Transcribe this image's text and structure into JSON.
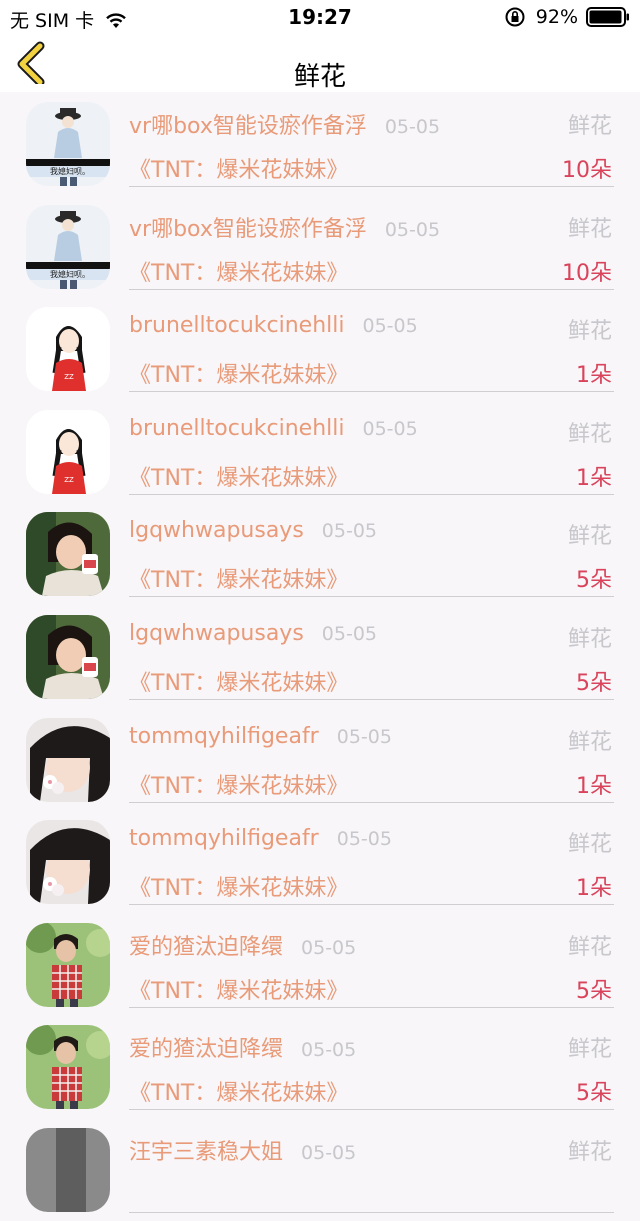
{
  "status_bar": {
    "carrier": "无 SIM 卡",
    "time": "19:27",
    "battery": "92%"
  },
  "nav": {
    "title": "鲜花",
    "back_icon": "chevron-left-icon"
  },
  "colors": {
    "accent": "#e99a78",
    "count": "#d9435b",
    "muted": "#c7c7cc"
  },
  "records": [
    {
      "avatar": "girl-hat-caption-avatar",
      "name": "vr哪box智能设瘀作备浮",
      "date": "05-05",
      "type": "鲜花",
      "work": "《TNT：爆米花妹妹》",
      "count": "10朵"
    },
    {
      "avatar": "girl-hat-caption-avatar",
      "name": "vr哪box智能设瘀作备浮",
      "date": "05-05",
      "type": "鲜花",
      "work": "《TNT：爆米花妹妹》",
      "count": "10朵"
    },
    {
      "avatar": "braids-girl-avatar",
      "name": "brunelltocukcinehlli",
      "date": "05-05",
      "type": "鲜花",
      "work": "《TNT：爆米花妹妹》",
      "count": "1朵"
    },
    {
      "avatar": "braids-girl-avatar",
      "name": "brunelltocukcinehlli",
      "date": "05-05",
      "type": "鲜花",
      "work": "《TNT：爆米花妹妹》",
      "count": "1朵"
    },
    {
      "avatar": "child-photo-avatar",
      "name": "lgqwhwapusays",
      "date": "05-05",
      "type": "鲜花",
      "work": "《TNT：爆米花妹妹》",
      "count": "5朵"
    },
    {
      "avatar": "child-photo-avatar",
      "name": "lgqwhwapusays",
      "date": "05-05",
      "type": "鲜花",
      "work": "《TNT：爆米花妹妹》",
      "count": "5朵"
    },
    {
      "avatar": "girl-flower-avatar",
      "name": "tommqyhilfigeafr",
      "date": "05-05",
      "type": "鲜花",
      "work": "《TNT：爆米花妹妹》",
      "count": "1朵"
    },
    {
      "avatar": "girl-flower-avatar",
      "name": "tommqyhilfigeafr",
      "date": "05-05",
      "type": "鲜花",
      "work": "《TNT：爆米花妹妹》",
      "count": "1朵"
    },
    {
      "avatar": "boy-plaid-avatar",
      "name": "爱的猹汰迫降缳",
      "date": "05-05",
      "type": "鲜花",
      "work": "《TNT：爆米花妹妹》",
      "count": "5朵"
    },
    {
      "avatar": "boy-plaid-avatar",
      "name": "爱的猹汰迫降缳",
      "date": "05-05",
      "type": "鲜花",
      "work": "《TNT：爆米花妹妹》",
      "count": "5朵"
    },
    {
      "avatar": "gray-photo-avatar",
      "name": "汪宇三素稳大姐",
      "date": "05-05",
      "type": "鲜花",
      "work": "",
      "count": ""
    }
  ]
}
